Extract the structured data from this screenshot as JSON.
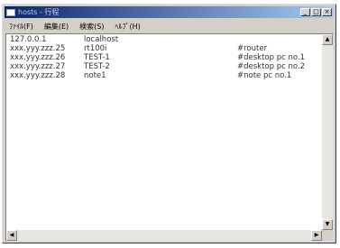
{
  "window": {
    "title": "hosts - 行程"
  },
  "menubar": {
    "items": [
      "ﾌｧｲﾙ(F)",
      "編集(E)",
      "検索(S)",
      "ﾍﾙﾌﾟ(H)"
    ]
  },
  "editor": {
    "rows": [
      {
        "ip": "127.0.0.1",
        "host": "localhost",
        "comment": ""
      },
      {
        "ip": "xxx.yyy.zzz.25",
        "host": "rt100i",
        "comment": "#router"
      },
      {
        "ip": "xxx.yyy.zzz.26",
        "host": "TEST-1",
        "comment": "#desktop pc no.1"
      },
      {
        "ip": "xxx.yyy.zzz.27",
        "host": "TEST-2",
        "comment": "#desktop pc no.2"
      },
      {
        "ip": "xxx.yyy.zzz.28",
        "host": "note1",
        "comment": "#note pc no.1"
      }
    ]
  },
  "icons": {
    "minimize": "minimize-icon",
    "maximize": "maximize-icon",
    "close": "close-icon"
  }
}
